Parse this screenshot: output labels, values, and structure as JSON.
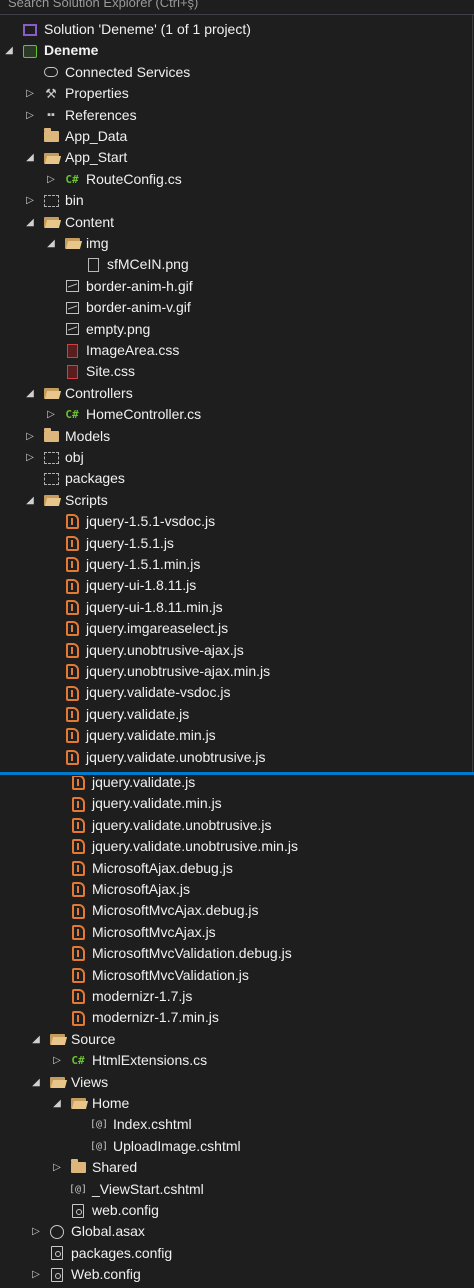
{
  "search": {
    "placeholder": "Search Solution Explorer (Ctrl+ş)"
  },
  "panel1": [
    {
      "depth": 0,
      "arrow": "",
      "icon": "solution-icon",
      "label": "Solution 'Deneme' (1 of 1 project)",
      "bold": false
    },
    {
      "depth": 0,
      "arrow": "expanded",
      "icon": "project-icon",
      "label": "Deneme",
      "bold": true
    },
    {
      "depth": 1,
      "arrow": "",
      "icon": "connected-services-icon",
      "label": "Connected Services"
    },
    {
      "depth": 1,
      "arrow": "collapsed",
      "icon": "wrench-icon",
      "label": "Properties"
    },
    {
      "depth": 1,
      "arrow": "collapsed",
      "icon": "references-icon",
      "label": "References"
    },
    {
      "depth": 1,
      "arrow": "",
      "icon": "folder-icon",
      "label": "App_Data"
    },
    {
      "depth": 1,
      "arrow": "expanded",
      "icon": "folder-open-icon",
      "label": "App_Start"
    },
    {
      "depth": 2,
      "arrow": "collapsed",
      "icon": "csharp-file-icon",
      "label": "RouteConfig.cs"
    },
    {
      "depth": 1,
      "arrow": "collapsed",
      "icon": "folder-dashed-icon",
      "label": "bin"
    },
    {
      "depth": 1,
      "arrow": "expanded",
      "icon": "folder-open-icon",
      "label": "Content"
    },
    {
      "depth": 2,
      "arrow": "expanded",
      "icon": "folder-open-icon",
      "label": "img"
    },
    {
      "depth": 3,
      "arrow": "",
      "icon": "file-icon",
      "label": "sfMCeIN.png"
    },
    {
      "depth": 2,
      "arrow": "",
      "icon": "image-file-icon",
      "label": "border-anim-h.gif"
    },
    {
      "depth": 2,
      "arrow": "",
      "icon": "image-file-icon",
      "label": "border-anim-v.gif"
    },
    {
      "depth": 2,
      "arrow": "",
      "icon": "image-file-icon",
      "label": "empty.png"
    },
    {
      "depth": 2,
      "arrow": "",
      "icon": "css-file-icon",
      "label": "ImageArea.css"
    },
    {
      "depth": 2,
      "arrow": "",
      "icon": "css-file-icon",
      "label": "Site.css"
    },
    {
      "depth": 1,
      "arrow": "expanded",
      "icon": "folder-open-icon",
      "label": "Controllers"
    },
    {
      "depth": 2,
      "arrow": "collapsed",
      "icon": "csharp-file-icon",
      "label": "HomeController.cs"
    },
    {
      "depth": 1,
      "arrow": "collapsed",
      "icon": "folder-icon",
      "label": "Models"
    },
    {
      "depth": 1,
      "arrow": "collapsed",
      "icon": "folder-dashed-icon",
      "label": "obj"
    },
    {
      "depth": 1,
      "arrow": "",
      "icon": "folder-dashed-icon",
      "label": "packages"
    },
    {
      "depth": 1,
      "arrow": "expanded",
      "icon": "folder-open-icon",
      "label": "Scripts"
    },
    {
      "depth": 2,
      "arrow": "",
      "icon": "js-file-icon",
      "label": "jquery-1.5.1-vsdoc.js"
    },
    {
      "depth": 2,
      "arrow": "",
      "icon": "js-file-icon",
      "label": "jquery-1.5.1.js"
    },
    {
      "depth": 2,
      "arrow": "",
      "icon": "js-file-icon",
      "label": "jquery-1.5.1.min.js"
    },
    {
      "depth": 2,
      "arrow": "",
      "icon": "js-file-icon",
      "label": "jquery-ui-1.8.11.js"
    },
    {
      "depth": 2,
      "arrow": "",
      "icon": "js-file-icon",
      "label": "jquery-ui-1.8.11.min.js"
    },
    {
      "depth": 2,
      "arrow": "",
      "icon": "js-file-icon",
      "label": "jquery.imgareaselect.js"
    },
    {
      "depth": 2,
      "arrow": "",
      "icon": "js-file-icon",
      "label": "jquery.unobtrusive-ajax.js"
    },
    {
      "depth": 2,
      "arrow": "",
      "icon": "js-file-icon",
      "label": "jquery.unobtrusive-ajax.min.js"
    },
    {
      "depth": 2,
      "arrow": "",
      "icon": "js-file-icon",
      "label": "jquery.validate-vsdoc.js"
    },
    {
      "depth": 2,
      "arrow": "",
      "icon": "js-file-icon",
      "label": "jquery.validate.js"
    },
    {
      "depth": 2,
      "arrow": "",
      "icon": "js-file-icon",
      "label": "jquery.validate.min.js"
    },
    {
      "depth": 2,
      "arrow": "",
      "icon": "js-file-icon",
      "label": "jquery.validate.unobtrusive.js"
    }
  ],
  "panel2": [
    {
      "depth": 2,
      "arrow": "",
      "icon": "js-file-icon",
      "label": "jquery.validate.js"
    },
    {
      "depth": 2,
      "arrow": "",
      "icon": "js-file-icon",
      "label": "jquery.validate.min.js"
    },
    {
      "depth": 2,
      "arrow": "",
      "icon": "js-file-icon",
      "label": "jquery.validate.unobtrusive.js"
    },
    {
      "depth": 2,
      "arrow": "",
      "icon": "js-file-icon",
      "label": "jquery.validate.unobtrusive.min.js"
    },
    {
      "depth": 2,
      "arrow": "",
      "icon": "js-file-icon",
      "label": "MicrosoftAjax.debug.js"
    },
    {
      "depth": 2,
      "arrow": "",
      "icon": "js-file-icon",
      "label": "MicrosoftAjax.js"
    },
    {
      "depth": 2,
      "arrow": "",
      "icon": "js-file-icon",
      "label": "MicrosoftMvcAjax.debug.js"
    },
    {
      "depth": 2,
      "arrow": "",
      "icon": "js-file-icon",
      "label": "MicrosoftMvcAjax.js"
    },
    {
      "depth": 2,
      "arrow": "",
      "icon": "js-file-icon",
      "label": "MicrosoftMvcValidation.debug.js"
    },
    {
      "depth": 2,
      "arrow": "",
      "icon": "js-file-icon",
      "label": "MicrosoftMvcValidation.js"
    },
    {
      "depth": 2,
      "arrow": "",
      "icon": "js-file-icon",
      "label": "modernizr-1.7.js"
    },
    {
      "depth": 2,
      "arrow": "",
      "icon": "js-file-icon",
      "label": "modernizr-1.7.min.js"
    },
    {
      "depth": 1,
      "arrow": "expanded",
      "icon": "folder-open-icon",
      "label": "Source"
    },
    {
      "depth": 2,
      "arrow": "collapsed",
      "icon": "csharp-file-icon",
      "label": "HtmlExtensions.cs"
    },
    {
      "depth": 1,
      "arrow": "expanded",
      "icon": "folder-open-icon",
      "label": "Views"
    },
    {
      "depth": 2,
      "arrow": "expanded",
      "icon": "folder-open-icon",
      "label": "Home"
    },
    {
      "depth": 3,
      "arrow": "",
      "icon": "cshtml-file-icon",
      "label": "Index.cshtml"
    },
    {
      "depth": 3,
      "arrow": "",
      "icon": "cshtml-file-icon",
      "label": "UploadImage.cshtml"
    },
    {
      "depth": 2,
      "arrow": "collapsed",
      "icon": "folder-icon",
      "label": "Shared"
    },
    {
      "depth": 2,
      "arrow": "",
      "icon": "cshtml-file-icon",
      "label": "_ViewStart.cshtml"
    },
    {
      "depth": 2,
      "arrow": "",
      "icon": "config-file-icon",
      "label": "web.config"
    },
    {
      "depth": 1,
      "arrow": "collapsed",
      "icon": "global-asax-icon",
      "label": "Global.asax"
    },
    {
      "depth": 1,
      "arrow": "",
      "icon": "config-file-icon",
      "label": "packages.config"
    },
    {
      "depth": 1,
      "arrow": "collapsed",
      "icon": "config-file-icon",
      "label": "Web.config"
    }
  ]
}
